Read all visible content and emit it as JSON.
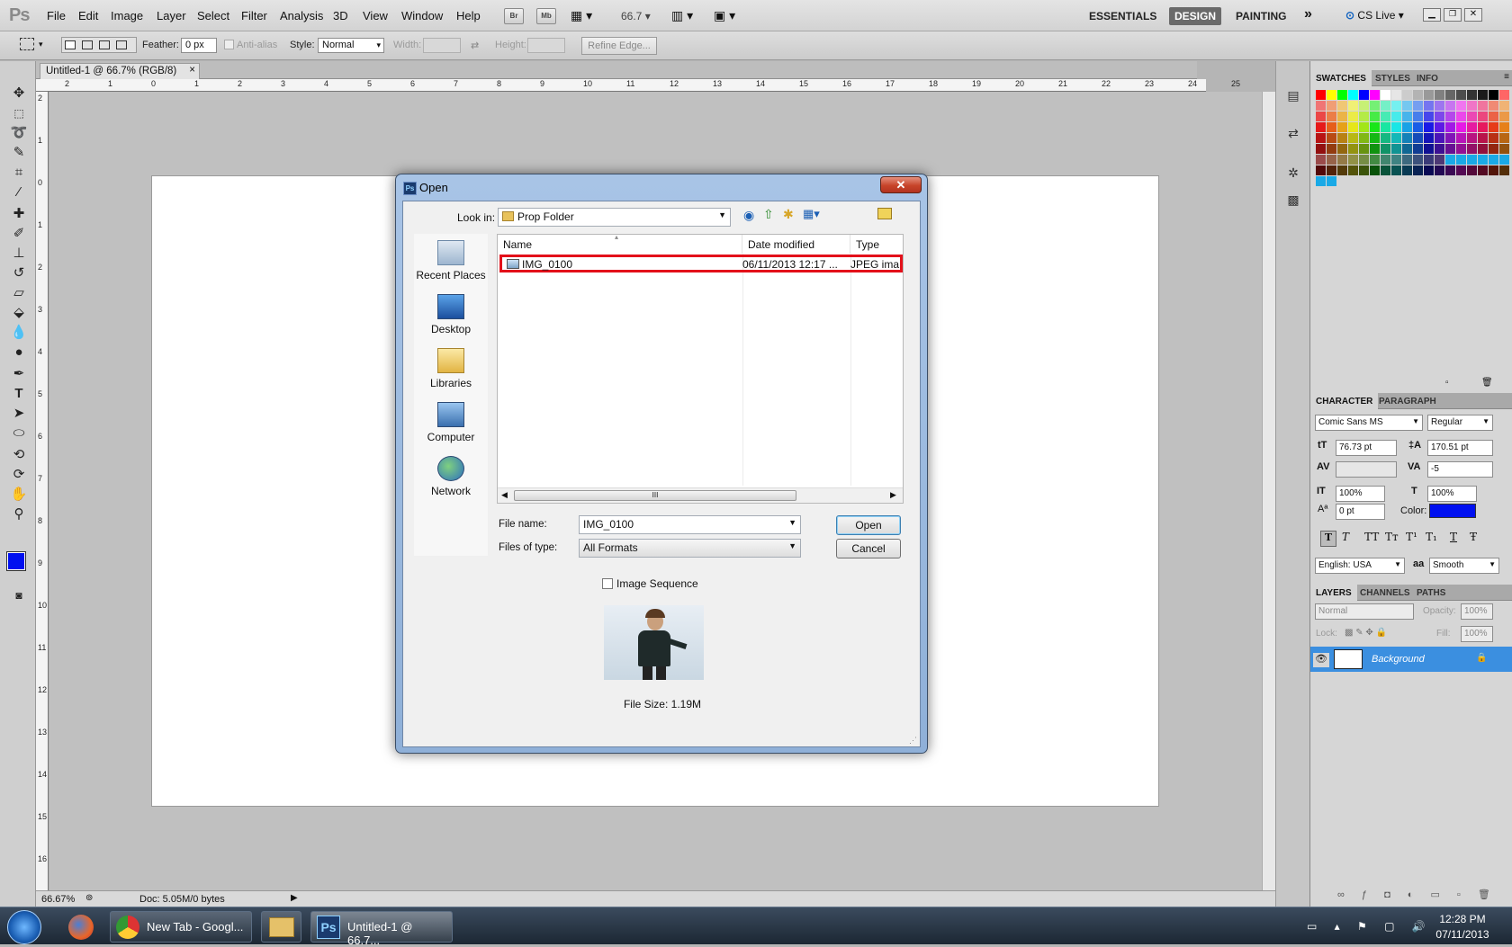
{
  "app": {
    "logo": "Ps",
    "menu": [
      "File",
      "Edit",
      "Image",
      "Layer",
      "Select",
      "Filter",
      "Analysis",
      "3D",
      "View",
      "Window",
      "Help"
    ],
    "zoom_combo": "66.7",
    "br_label": "Br",
    "mb_label": "Mb",
    "workspaces": [
      "ESSENTIALS",
      "DESIGN",
      "PAINTING"
    ],
    "more_label": "»",
    "cs_live": "CS Live"
  },
  "options": {
    "feather_label": "Feather:",
    "feather_value": "0 px",
    "antialias_label": "Anti-alias",
    "style_label": "Style:",
    "style_value": "Normal",
    "width_label": "Width:",
    "height_label": "Height:",
    "refine_label": "Refine Edge..."
  },
  "document": {
    "tab_title": "Untitled-1 @ 66.7% (RGB/8)",
    "tab_close": "×",
    "ruler_top": [
      "2",
      "1",
      "0",
      "1",
      "2",
      "3",
      "4",
      "5",
      "6",
      "7",
      "8",
      "9",
      "10",
      "11",
      "12",
      "13",
      "14",
      "15",
      "16",
      "17",
      "18",
      "19",
      "20",
      "21",
      "22",
      "23",
      "24",
      "25"
    ],
    "ruler_left": [
      "2",
      "1",
      "0",
      "1",
      "2",
      "3",
      "4",
      "5",
      "6",
      "7",
      "8",
      "9",
      "10",
      "11",
      "12",
      "13",
      "14",
      "15",
      "16"
    ]
  },
  "status": {
    "zoom": "66.67%",
    "doc": "Doc: 5.05M/0 bytes"
  },
  "swatches": {
    "tabs": [
      "SWATCHES",
      "STYLES",
      "INFO"
    ]
  },
  "character": {
    "tabs": [
      "CHARACTER",
      "PARAGRAPH"
    ],
    "font": "Comic Sans MS",
    "style": "Regular",
    "size": "76.73 pt",
    "leading": "170.51 pt",
    "kerning": "",
    "tracking": "-5",
    "vscale": "100%",
    "hscale": "100%",
    "baseline": "0 pt",
    "color_label": "Color:",
    "color": "#0010f0",
    "language": "English: USA",
    "aa_label": "a​a",
    "aa": "Smooth",
    "fmt_buttons": [
      "T",
      "T",
      "TT",
      "Tт",
      "T¹",
      "T₁",
      "T",
      "Ŧ"
    ]
  },
  "layers": {
    "tabs": [
      "LAYERS",
      "CHANNELS",
      "PATHS"
    ],
    "mode": "Normal",
    "opacity_label": "Opacity:",
    "opacity": "100%",
    "lock_label": "Lock:",
    "fill_label": "Fill:",
    "fill": "100%",
    "layer_name": "Background"
  },
  "dialog": {
    "title": "Open",
    "ps": "Ps",
    "close": "✕",
    "look_in_label": "Look in:",
    "folder": "Prop Folder",
    "places": [
      "Recent Places",
      "Desktop",
      "Libraries",
      "Computer",
      "Network"
    ],
    "columns": [
      "Name",
      "Date modified",
      "Type"
    ],
    "file": {
      "name": "IMG_0100",
      "date": "06/11/2013 12:17 ...",
      "type": "JPEG ima"
    },
    "filename_label": "File name:",
    "filename": "IMG_0100",
    "filetype_label": "Files of type:",
    "filetype": "All Formats",
    "open": "Open",
    "cancel": "Cancel",
    "sequence_label": "Image Sequence",
    "filesize": "File Size: 1.19M",
    "scroll_grip": "III"
  },
  "taskbar": {
    "items": [
      "New Tab - Googl...",
      "Untitled-1 @ 66.7..."
    ],
    "time": "12:28 PM",
    "date": "07/11/2013"
  }
}
